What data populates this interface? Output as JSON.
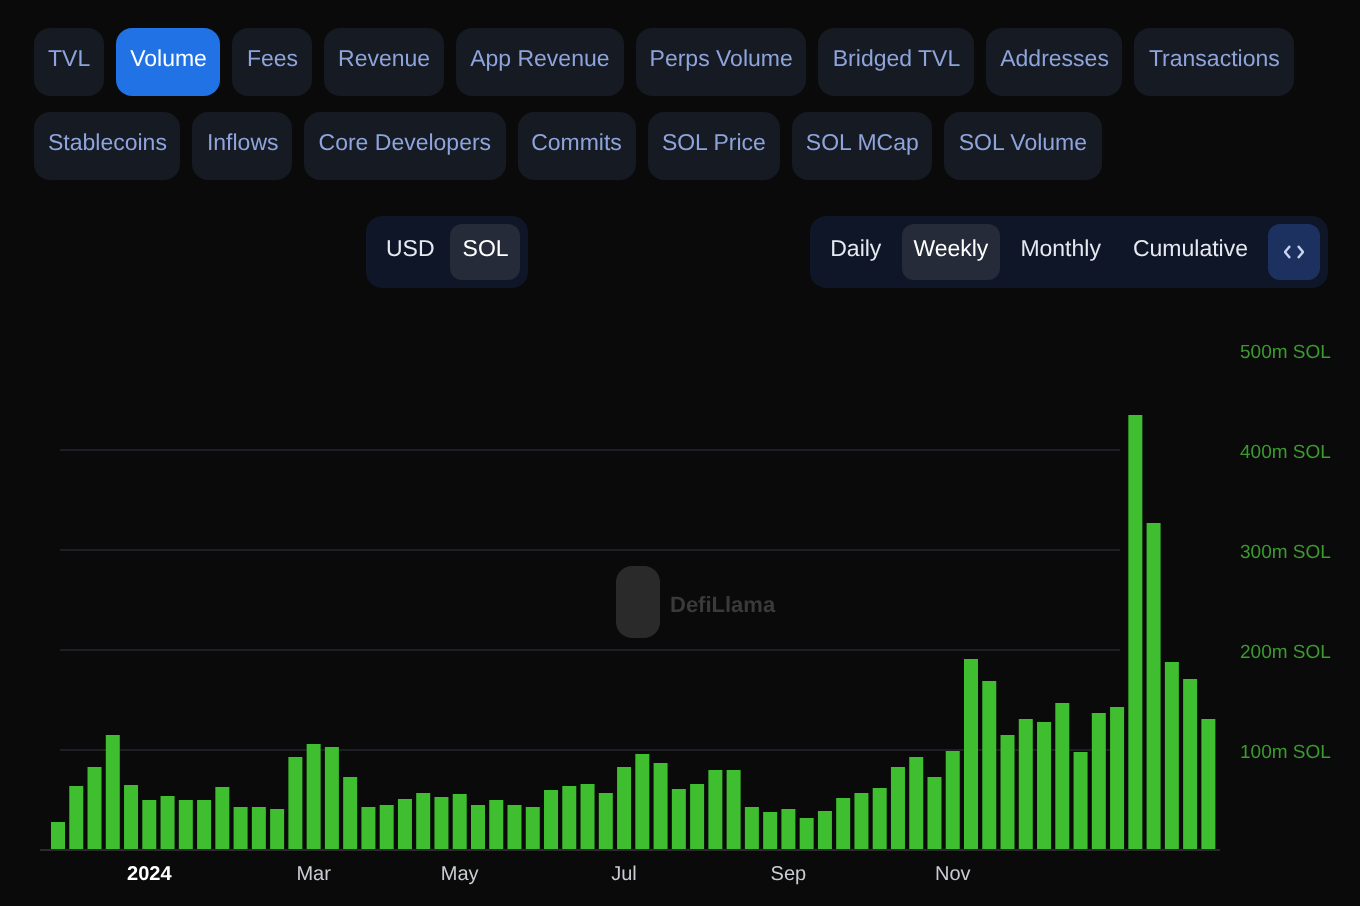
{
  "metric_tabs": [
    {
      "label": "TVL",
      "selected": false
    },
    {
      "label": "Volume",
      "selected": true
    },
    {
      "label": "Fees",
      "selected": false
    },
    {
      "label": "Revenue",
      "selected": false
    },
    {
      "label": "App Revenue",
      "selected": false
    },
    {
      "label": "Perps Volume",
      "selected": false
    },
    {
      "label": "Bridged TVL",
      "selected": false
    },
    {
      "label": "Addresses",
      "selected": false
    },
    {
      "label": "Transactions",
      "selected": false
    },
    {
      "label": "Stablecoins",
      "selected": false
    },
    {
      "label": "Inflows",
      "selected": false
    },
    {
      "label": "Core Developers",
      "selected": false
    },
    {
      "label": "Commits",
      "selected": false
    },
    {
      "label": "SOL Price",
      "selected": false
    },
    {
      "label": "SOL MCap",
      "selected": false
    },
    {
      "label": "SOL Volume",
      "selected": false
    }
  ],
  "currency_toggle": [
    {
      "label": "USD",
      "selected": false
    },
    {
      "label": "SOL",
      "selected": true
    }
  ],
  "period_toggle": [
    {
      "label": "Daily",
      "selected": false
    },
    {
      "label": "Weekly",
      "selected": true
    },
    {
      "label": "Monthly",
      "selected": false
    },
    {
      "label": "Cumulative",
      "selected": false
    }
  ],
  "chart": {
    "watermark": "DefiLlama",
    "chart_data": {
      "type": "bar",
      "categories": [
        null,
        null,
        null,
        null,
        null,
        "2024",
        null,
        null,
        null,
        null,
        null,
        null,
        null,
        null,
        "Mar",
        null,
        null,
        null,
        null,
        null,
        null,
        null,
        "May",
        null,
        null,
        null,
        null,
        null,
        null,
        null,
        null,
        "Jul",
        null,
        null,
        null,
        null,
        null,
        null,
        null,
        null,
        "Sep",
        null,
        null,
        null,
        null,
        null,
        null,
        null,
        null,
        "Nov",
        null,
        null,
        null,
        null,
        null,
        null,
        null,
        null,
        null,
        null,
        null,
        null,
        null,
        null
      ],
      "values": [
        28,
        64,
        83,
        115,
        65,
        50,
        54,
        50,
        50,
        63,
        43,
        43,
        41,
        93,
        106,
        103,
        73,
        43,
        45,
        51,
        57,
        53,
        56,
        45,
        50,
        45,
        43,
        60,
        64,
        66,
        57,
        83,
        96,
        87,
        61,
        66,
        80,
        80,
        43,
        38,
        41,
        32,
        39,
        52,
        57,
        62,
        83,
        93,
        73,
        99,
        191,
        169,
        115,
        131,
        128,
        147,
        98,
        137,
        143,
        435,
        327,
        188,
        171,
        131
      ],
      "ylim": [
        0,
        500
      ],
      "grid": true,
      "yticks": [
        {
          "value": 100,
          "label": "100m SOL"
        },
        {
          "value": 200,
          "label": "200m SOL"
        },
        {
          "value": 300,
          "label": "300m SOL"
        },
        {
          "value": 400,
          "label": "400m SOL"
        },
        {
          "value": 500,
          "label": "500m SOL"
        }
      ]
    }
  }
}
